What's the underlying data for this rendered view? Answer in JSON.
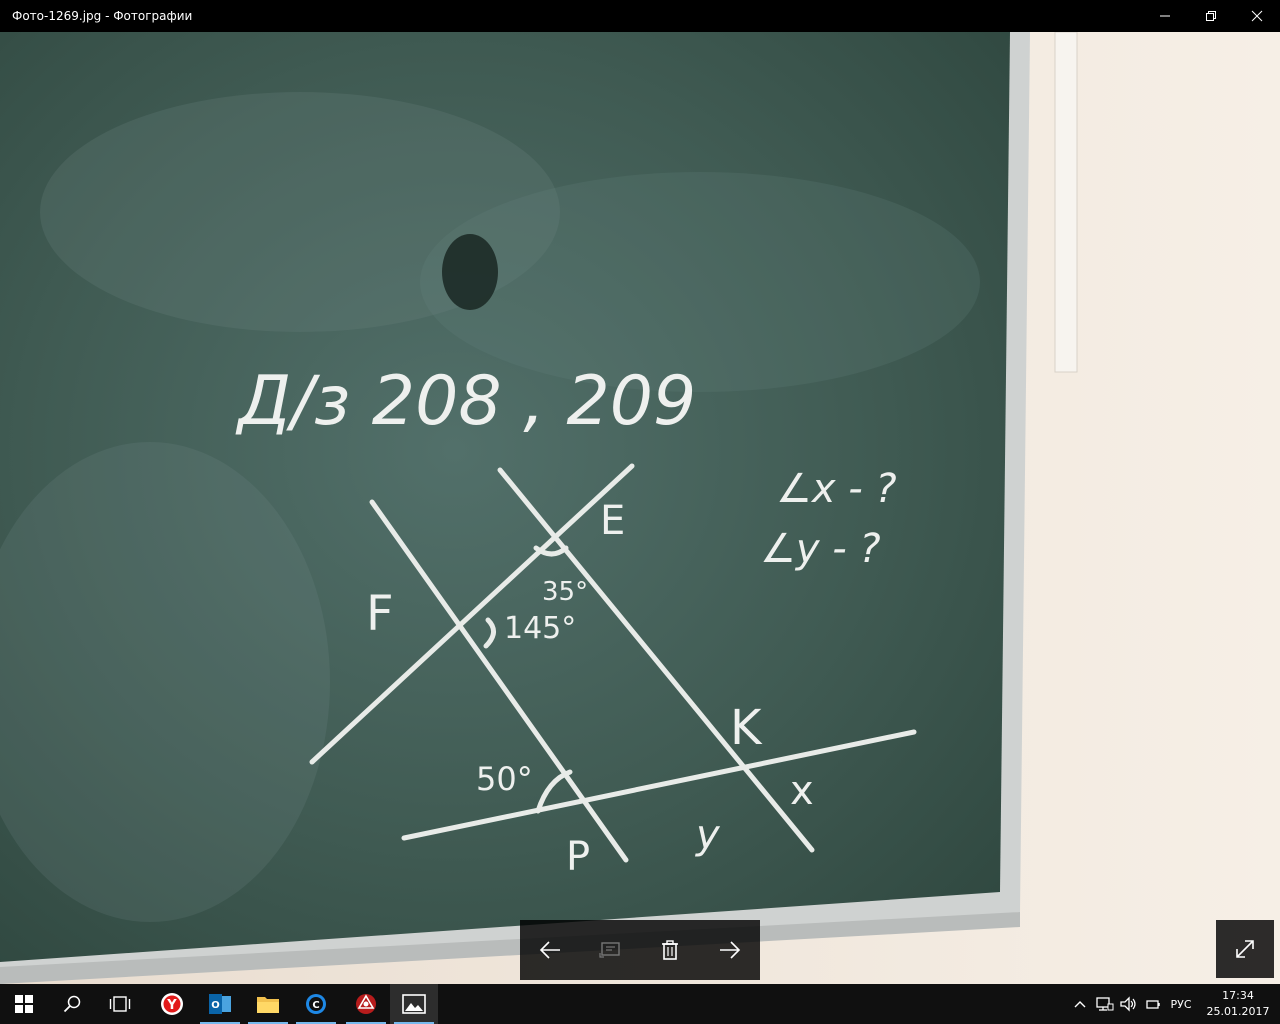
{
  "window": {
    "title": "Фото-1269.jpg - Фотографии"
  },
  "photo": {
    "board": {
      "homework": "Д/з 208 , 209",
      "question_x": "∠x - ?",
      "question_y": "∠y - ?",
      "point_e": "E",
      "point_f": "F",
      "point_k": "K",
      "point_p": "P",
      "label_x": "x",
      "label_y": "y",
      "angle_35": "35°",
      "angle_145": "145°",
      "angle_50": "50°"
    }
  },
  "toolbar": {
    "prev_icon": "arrow-left-icon",
    "slideshow_icon": "slideshow-icon",
    "delete_icon": "trash-icon",
    "next_icon": "arrow-right-icon",
    "fullscreen_icon": "expand-icon"
  },
  "taskbar": {
    "language": "РУС",
    "time": "17:34",
    "date": "25.01.2017",
    "apps": [
      "start",
      "search",
      "task-view",
      "yandex-browser",
      "outlook",
      "file-explorer",
      "chrome-like",
      "unknown-red-app",
      "photos"
    ]
  },
  "colors": {
    "board": "#3f5a52",
    "chalk": "#eef0ee",
    "wall": "#f1e8dc",
    "taskbar": "#101010",
    "accent": "#76b9ed"
  }
}
